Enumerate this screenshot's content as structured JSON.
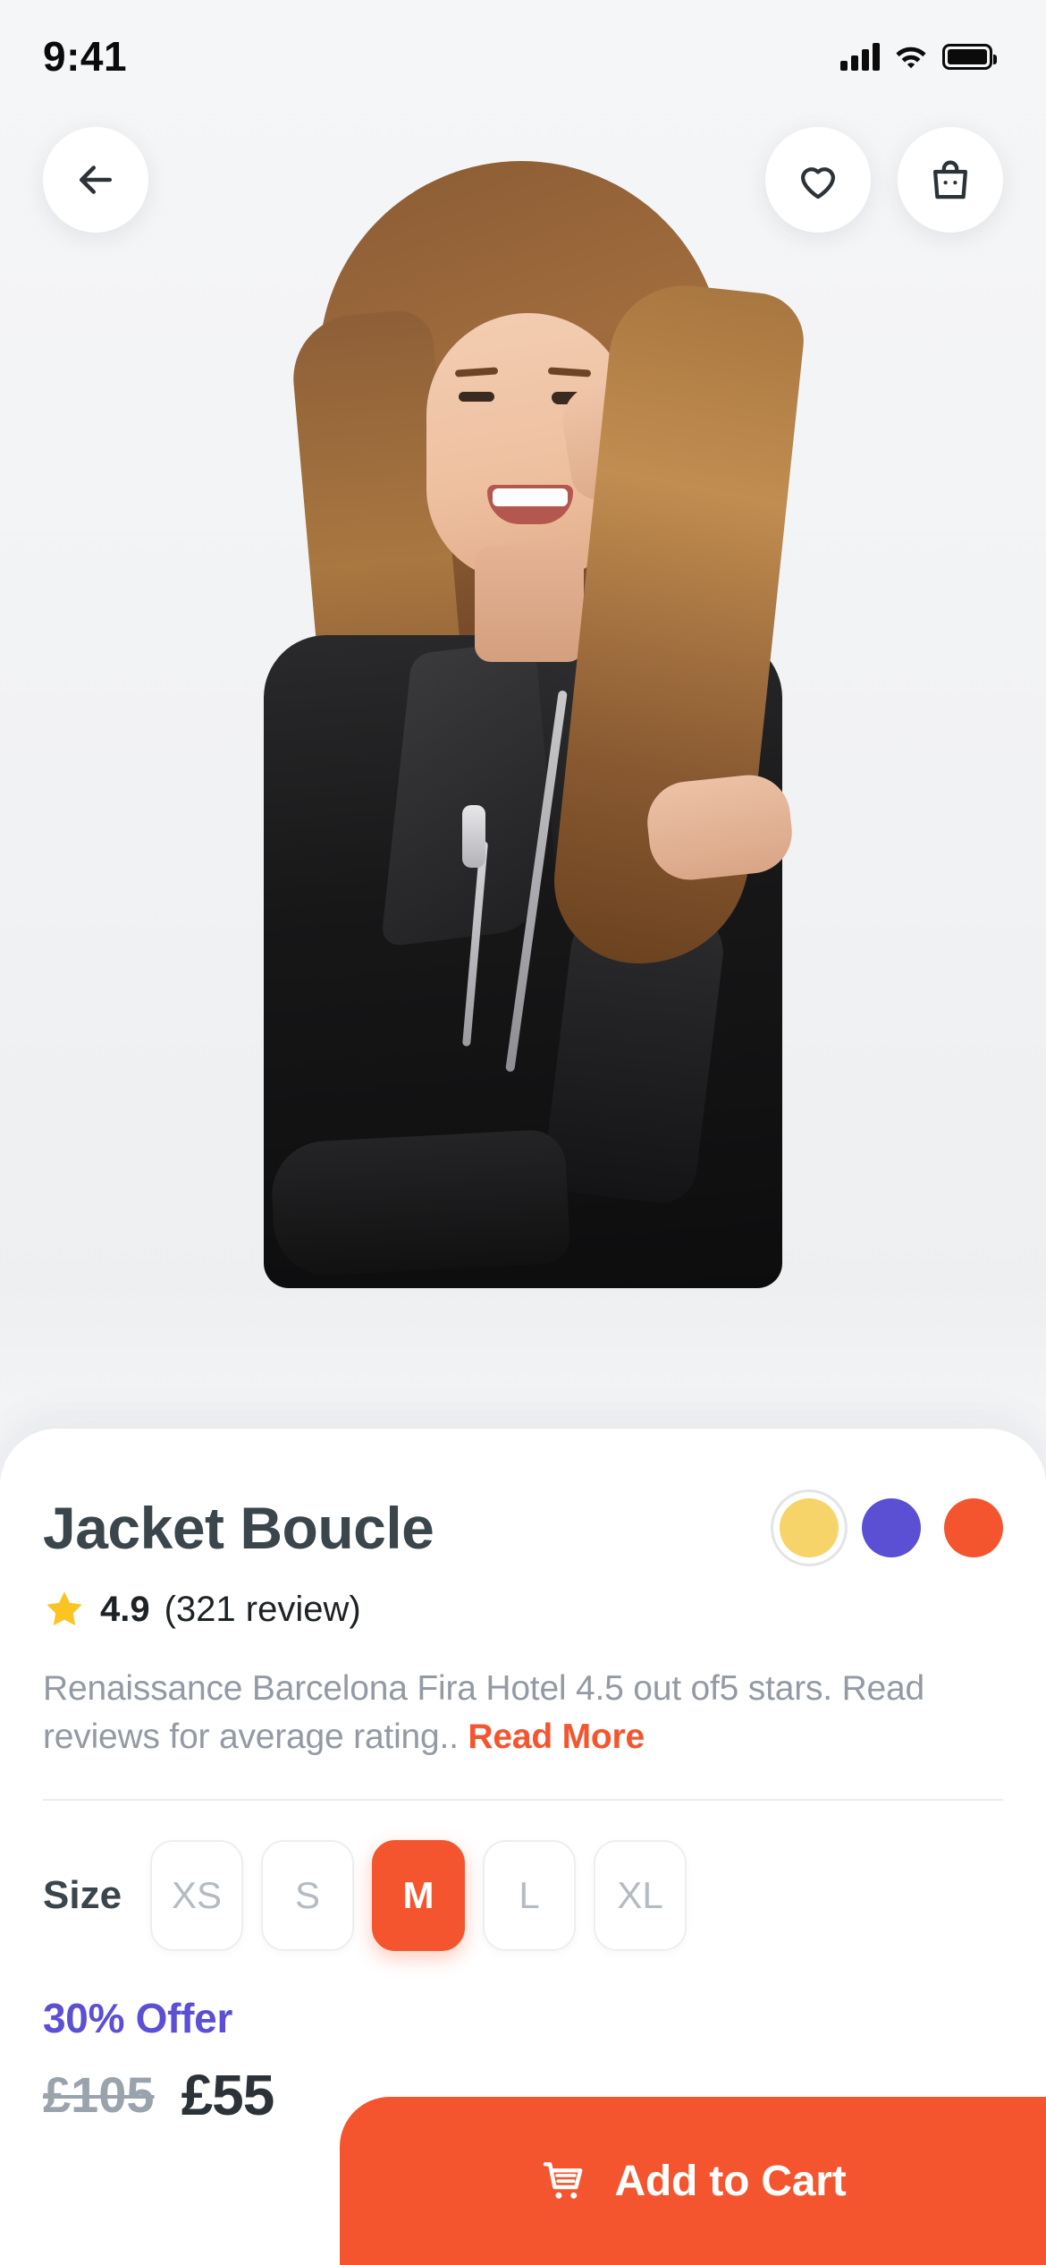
{
  "status_bar": {
    "time": "9:41",
    "signal_icon": "cellular-signal-icon",
    "wifi_icon": "wifi-icon",
    "battery_icon": "battery-icon"
  },
  "top_nav": {
    "back_icon": "arrow-left-icon",
    "favorite_icon": "heart-icon",
    "bag_icon": "shopping-bag-icon"
  },
  "product": {
    "title": "Jacket Boucle",
    "image_alt": "woman-wearing-black-leather-jacket",
    "colors": [
      {
        "name": "yellow",
        "hex": "#f7d469",
        "selected": true
      },
      {
        "name": "purple",
        "hex": "#5b4fd4",
        "selected": false
      },
      {
        "name": "orange",
        "hex": "#f4552e",
        "selected": false
      }
    ],
    "rating": {
      "star_icon": "star-icon",
      "value": "4.9",
      "count": "(321 review)"
    },
    "description": "Renaissance Barcelona Fira Hotel 4.5 out of5 stars. Read reviews for average rating..",
    "read_more_label": "Read More",
    "size": {
      "label": "Size",
      "options": [
        "XS",
        "S",
        "M",
        "L",
        "XL"
      ],
      "selected": "M"
    },
    "offer_label": "30% Offer",
    "price_old": "£105",
    "price_new": "£55"
  },
  "cta": {
    "cart_icon": "shopping-cart-icon",
    "label": "Add to Cart"
  },
  "colors": {
    "accent": "#f4552e",
    "offer": "#5b4fd4",
    "title": "#3a464c",
    "muted": "#939aa3",
    "page_bg": "#f4f5f7",
    "card_bg": "#ffffff"
  }
}
